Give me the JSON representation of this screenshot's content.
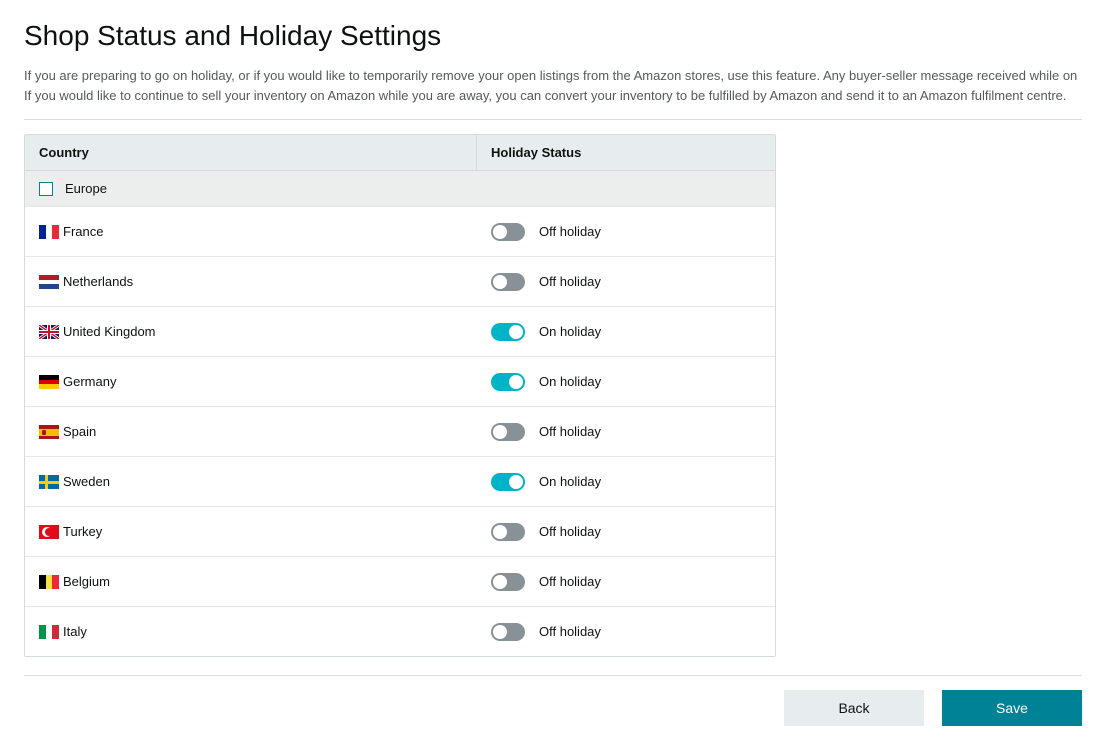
{
  "title": "Shop Status and Holiday Settings",
  "description_line1": "If you are preparing to go on holiday, or if you would like to temporarily remove your open listings from the Amazon stores, use this feature. Any buyer-seller message received while on",
  "description_line2": "If you would like to continue to sell your inventory on Amazon while you are away, you can convert your inventory to be fulfilled by Amazon and send it to an Amazon fulfilment centre.",
  "table": {
    "header_country": "Country",
    "header_status": "Holiday Status",
    "group_label": "Europe",
    "status_on": "On holiday",
    "status_off": "Off holiday",
    "rows": [
      {
        "country": "France",
        "flag": "fr",
        "on_holiday": false
      },
      {
        "country": "Netherlands",
        "flag": "nl",
        "on_holiday": false
      },
      {
        "country": "United Kingdom",
        "flag": "uk",
        "on_holiday": true
      },
      {
        "country": "Germany",
        "flag": "de",
        "on_holiday": true
      },
      {
        "country": "Spain",
        "flag": "es",
        "on_holiday": false
      },
      {
        "country": "Sweden",
        "flag": "se",
        "on_holiday": true
      },
      {
        "country": "Turkey",
        "flag": "tr",
        "on_holiday": false
      },
      {
        "country": "Belgium",
        "flag": "be",
        "on_holiday": false
      },
      {
        "country": "Italy",
        "flag": "it",
        "on_holiday": false
      }
    ]
  },
  "buttons": {
    "back": "Back",
    "save": "Save"
  }
}
